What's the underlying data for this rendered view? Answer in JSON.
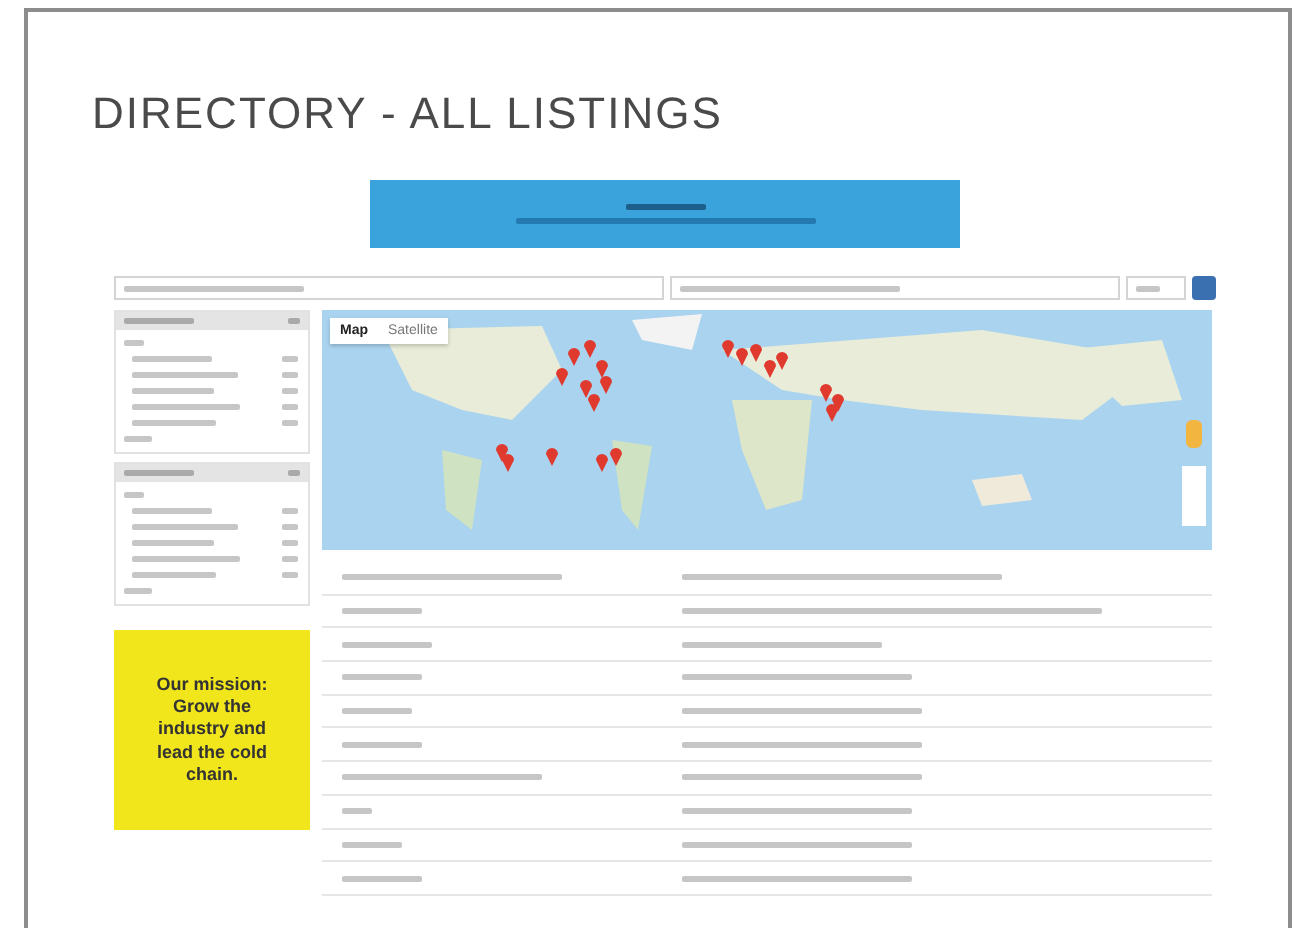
{
  "title": "DIRECTORY - ALL LISTINGS",
  "map": {
    "tabs": [
      {
        "label": "Map",
        "selected": true
      },
      {
        "label": "Satellite",
        "selected": false
      }
    ]
  },
  "mission": {
    "heading": "Our mission:",
    "text": "Grow the industry and lead the cold chain."
  }
}
